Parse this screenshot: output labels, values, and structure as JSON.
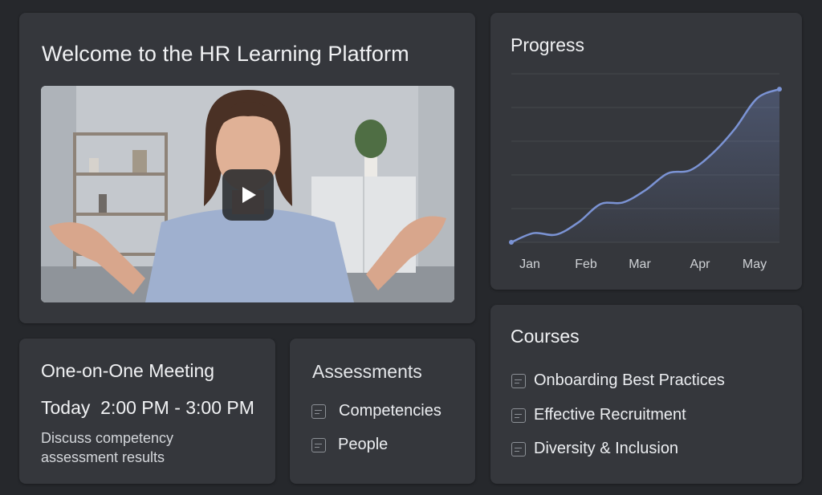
{
  "welcome": {
    "title": "Welcome to the HR Learning Platform"
  },
  "progress": {
    "title": "Progress"
  },
  "chart_data": {
    "type": "area",
    "title": "Progress",
    "categories": [
      "Jan",
      "Feb",
      "Mar",
      "Apr",
      "May"
    ],
    "x": [
      0,
      0.5,
      1,
      1.5,
      2,
      2.5,
      3,
      3.5,
      4,
      4.5,
      5,
      5.5,
      6,
      6.5,
      7,
      7.5,
      8
    ],
    "values": [
      0,
      6,
      5,
      13,
      25,
      26,
      34,
      45,
      47,
      58,
      74,
      94,
      100
    ],
    "ylim": [
      0,
      110
    ],
    "grid": true,
    "legend": "none",
    "line_color": "#7b93d4"
  },
  "meeting": {
    "title": "One-on-One Meeting",
    "time": "Today  2:00 PM - 3:00 PM",
    "description": "Discuss competency assessment results"
  },
  "assessments": {
    "title": "Assessments",
    "items": [
      {
        "label": "Competencies",
        "icon": "document-icon"
      },
      {
        "label": "People",
        "icon": "document-icon"
      }
    ]
  },
  "courses": {
    "title": "Courses",
    "items": [
      {
        "label": "Onboarding Best Practices",
        "icon": "document-icon"
      },
      {
        "label": "Effective Recruitment",
        "icon": "document-icon"
      },
      {
        "label": "Diversity & Inclusion",
        "icon": "document-icon"
      }
    ]
  },
  "colors": {
    "background": "#26282c",
    "card": "#35373c",
    "accent": "#7b93d4"
  }
}
